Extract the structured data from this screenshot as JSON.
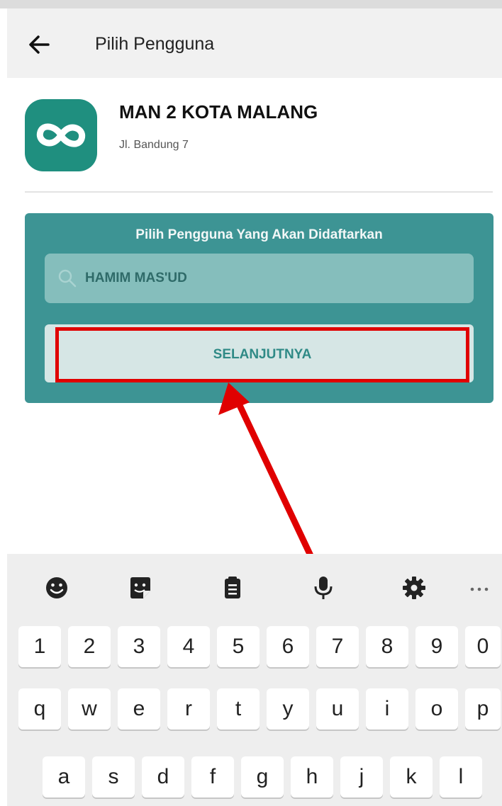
{
  "appbar": {
    "title": "Pilih Pengguna"
  },
  "school": {
    "name": "MAN 2 KOTA MALANG",
    "address": "Jl. Bandung 7"
  },
  "card": {
    "title": "Pilih Pengguna Yang Akan Didaftarkan",
    "search_value": "HAMIM MAS'UD",
    "next_label": "SELANJUTNYA"
  },
  "keyboard": {
    "toolbar": [
      "emoji-icon",
      "sticker-icon",
      "clipboard-icon",
      "microphone-icon",
      "gear-icon",
      "more-icon"
    ],
    "rows": [
      [
        "1",
        "2",
        "3",
        "4",
        "5",
        "6",
        "7",
        "8",
        "9",
        "0"
      ],
      [
        "q",
        "w",
        "e",
        "r",
        "t",
        "y",
        "u",
        "i",
        "o",
        "p"
      ],
      [
        "a",
        "s",
        "d",
        "f",
        "g",
        "h",
        "j",
        "k",
        "l"
      ]
    ]
  },
  "colors": {
    "teal": "#3d9494",
    "logo": "#1f8f7f",
    "highlight": "#e00000"
  }
}
